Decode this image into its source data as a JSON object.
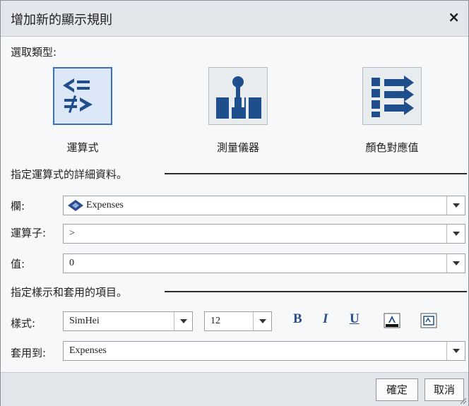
{
  "dialog": {
    "title": "增加新的顯示規則",
    "close_glyph": "×"
  },
  "type_section": {
    "label": "選取類型:",
    "types": [
      {
        "label": "運算式",
        "icon": "expression-icon",
        "selected": true
      },
      {
        "label": "測量儀器",
        "icon": "gauge-icon",
        "selected": false
      },
      {
        "label": "顏色對應值",
        "icon": "color-mapped-values-icon",
        "selected": false
      }
    ]
  },
  "details_section": {
    "label": "指定運算式的詳細資料。",
    "column": {
      "label": "欄:",
      "value": "Expenses",
      "icon": "measure-diamond-icon"
    },
    "operator": {
      "label": "運算子:",
      "value": ">"
    },
    "value": {
      "label": "值:",
      "value": "0"
    }
  },
  "style_section": {
    "label": "指定樣示和套用的項目。",
    "style": {
      "label": "樣式:",
      "font": "SimHei",
      "size": "12"
    },
    "format_buttons": {
      "bold": "B",
      "italic": "I",
      "underline": "U"
    },
    "apply_to": {
      "label": "套用到:",
      "value": "Expenses"
    }
  },
  "footer": {
    "ok_label": "確定",
    "cancel_label": "取消"
  },
  "colors": {
    "accent_blue": "#1f4e8c",
    "selected_border": "#3a6fc4"
  }
}
